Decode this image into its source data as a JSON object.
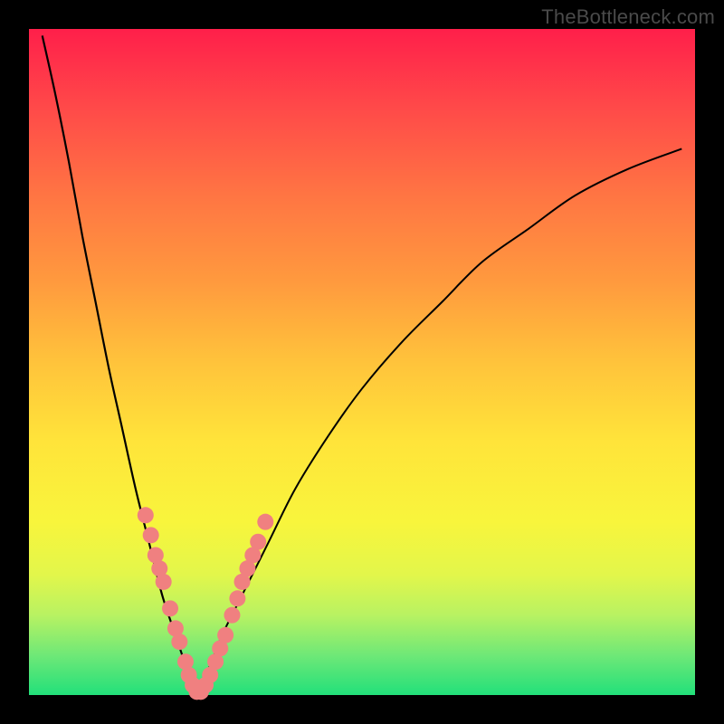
{
  "watermark": "TheBottleneck.com",
  "colors": {
    "frame": "#000000",
    "curve": "#000000",
    "marker_fill": "#f08080",
    "marker_stroke": "#d86e6e",
    "gradient_top": "#ff1f4a",
    "gradient_bottom": "#22e07a"
  },
  "chart_data": {
    "type": "line",
    "title": "",
    "xlabel": "",
    "ylabel": "",
    "xlim": [
      0,
      100
    ],
    "ylim": [
      0,
      100
    ],
    "grid": false,
    "legend": false,
    "note": "Two-branch V-shaped bottleneck curve; y ≈ 0 at x ≈ 25 (optimal point). Axis values estimated from figure proportions (no ticks shown).",
    "series": [
      {
        "name": "left_branch",
        "x": [
          2,
          4,
          6,
          8,
          10,
          12,
          14,
          16,
          18,
          20,
          22,
          24,
          25
        ],
        "y": [
          99,
          90,
          80,
          69,
          59,
          49,
          40,
          31,
          23,
          15,
          9,
          3,
          0
        ]
      },
      {
        "name": "right_branch",
        "x": [
          25,
          27,
          29,
          32,
          36,
          40,
          45,
          50,
          56,
          62,
          68,
          75,
          82,
          90,
          98
        ],
        "y": [
          0,
          4,
          9,
          15,
          23,
          31,
          39,
          46,
          53,
          59,
          65,
          70,
          75,
          79,
          82
        ]
      }
    ],
    "markers": {
      "name": "highlighted_points",
      "note": "Pink salmon dots clustered near the valley on both branches",
      "points": [
        {
          "x": 17.5,
          "y": 27
        },
        {
          "x": 18.3,
          "y": 24
        },
        {
          "x": 19.0,
          "y": 21
        },
        {
          "x": 19.6,
          "y": 19
        },
        {
          "x": 20.2,
          "y": 17
        },
        {
          "x": 21.2,
          "y": 13
        },
        {
          "x": 22.0,
          "y": 10
        },
        {
          "x": 22.6,
          "y": 8
        },
        {
          "x": 23.5,
          "y": 5
        },
        {
          "x": 24.0,
          "y": 3
        },
        {
          "x": 24.6,
          "y": 1.5
        },
        {
          "x": 25.2,
          "y": 0.5
        },
        {
          "x": 25.8,
          "y": 0.5
        },
        {
          "x": 26.5,
          "y": 1.5
        },
        {
          "x": 27.2,
          "y": 3
        },
        {
          "x": 28.0,
          "y": 5
        },
        {
          "x": 28.7,
          "y": 7
        },
        {
          "x": 29.5,
          "y": 9
        },
        {
          "x": 30.5,
          "y": 12
        },
        {
          "x": 31.3,
          "y": 14.5
        },
        {
          "x": 32.0,
          "y": 17
        },
        {
          "x": 32.8,
          "y": 19
        },
        {
          "x": 33.6,
          "y": 21
        },
        {
          "x": 34.4,
          "y": 23
        },
        {
          "x": 35.5,
          "y": 26
        }
      ]
    }
  }
}
